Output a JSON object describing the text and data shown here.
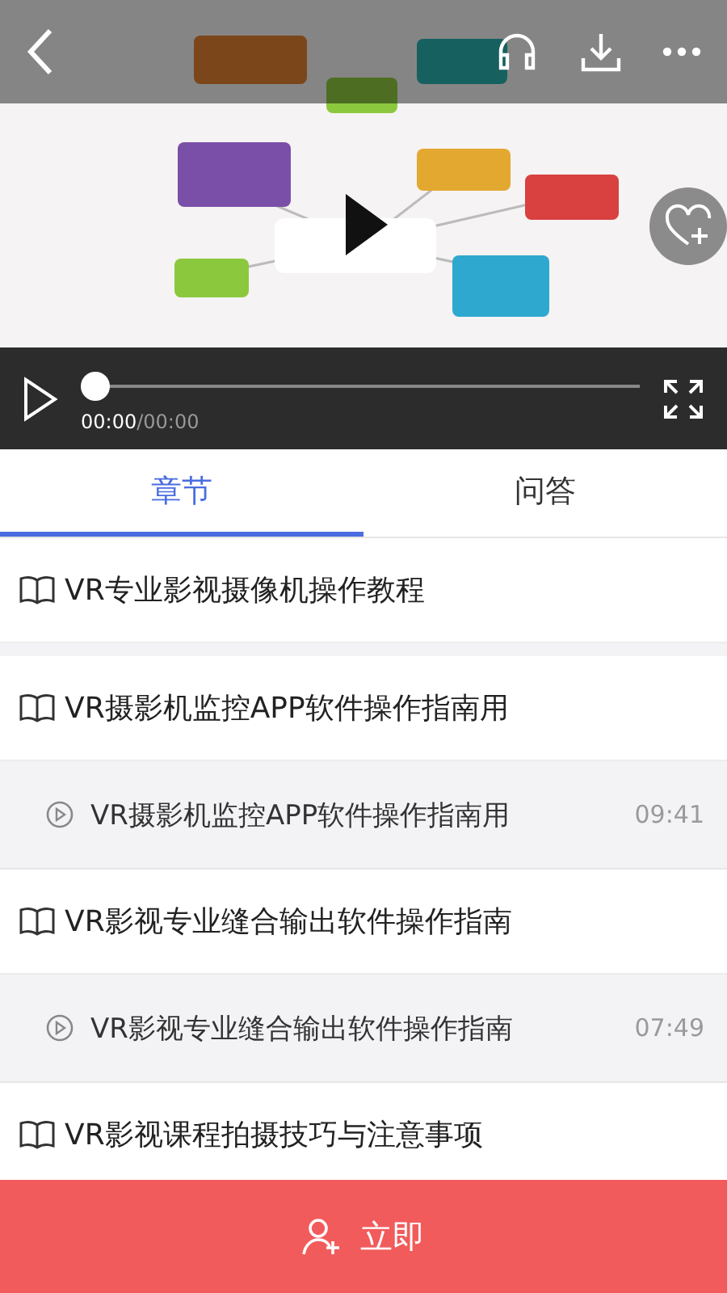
{
  "player": {
    "elapsed": "00:00",
    "duration": "/00:00",
    "level": 0
  },
  "tabs": [
    {
      "label": "章节",
      "selected": true
    },
    {
      "label": "问答",
      "selected": false
    }
  ],
  "items": [
    {
      "kind": "chapter",
      "title": "VR专业影视摄像机操作教程"
    },
    {
      "kind": "gap"
    },
    {
      "kind": "chapter",
      "title": "VR摄影机监控APP软件操作指南用"
    },
    {
      "kind": "lesson",
      "title": "VR摄影机监控APP软件操作指南用",
      "time": "09:41"
    },
    {
      "kind": "chapter",
      "title": "VR影视专业缝合输出软件操作指南"
    },
    {
      "kind": "lesson",
      "title": "VR影视专业缝合输出软件操作指南",
      "time": "07:49"
    },
    {
      "kind": "chapter",
      "title": "VR影视课程拍摄技巧与注意事项"
    }
  ],
  "action": {
    "label": "立即"
  }
}
